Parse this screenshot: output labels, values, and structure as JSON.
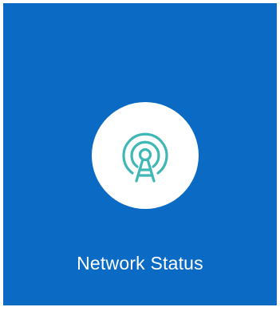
{
  "tile": {
    "label": "Network Status",
    "icon": "broadcast-tower-icon",
    "background_color": "#0b6ac4",
    "icon_color": "#3fb7b5",
    "circle_color": "#ffffff"
  }
}
